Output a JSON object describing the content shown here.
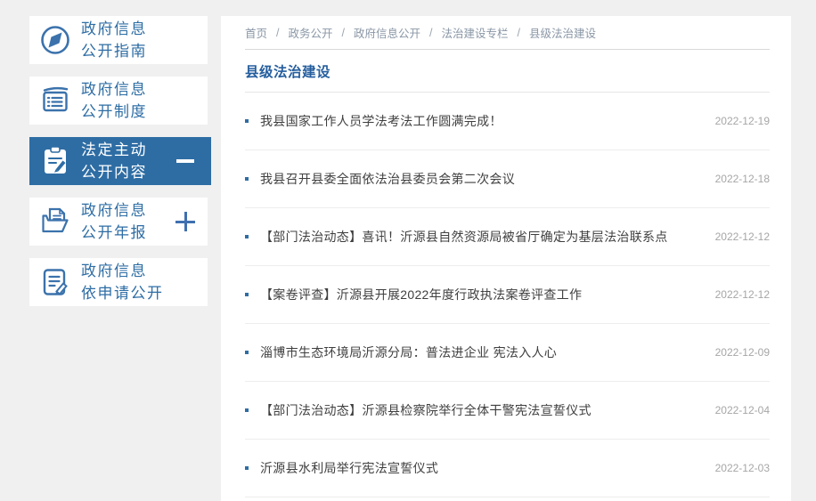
{
  "colors": {
    "accent": "#2e6da4",
    "page_background": "#f0f0f1",
    "panel_background": "#ffffff",
    "date_gray": "#a6a6a6"
  },
  "sidebar": {
    "items": [
      {
        "icon": "compass-icon",
        "lines": [
          "政府信息",
          "公开指南"
        ],
        "active": false,
        "expander": null
      },
      {
        "icon": "notebook-list-icon",
        "lines": [
          "政府信息",
          "公开制度"
        ],
        "active": false,
        "expander": null
      },
      {
        "icon": "clipboard-pen-icon",
        "lines": [
          "法定主动",
          "公开内容"
        ],
        "active": true,
        "expander": "minus"
      },
      {
        "icon": "folder-document-icon",
        "lines": [
          "政府信息",
          "公开年报"
        ],
        "active": false,
        "expander": "plus"
      },
      {
        "icon": "document-pen-icon",
        "lines": [
          "政府信息",
          "依申请公开"
        ],
        "active": false,
        "expander": null
      }
    ]
  },
  "breadcrumb": {
    "separator": "/",
    "items": [
      "首页",
      "政务公开",
      "政府信息公开",
      "法治建设专栏",
      "县级法治建设"
    ]
  },
  "main": {
    "section_title": "县级法治建设",
    "articles": [
      {
        "title": "我县国家工作人员学法考法工作圆满完成！",
        "date": "2022-12-19"
      },
      {
        "title": "我县召开县委全面依法治县委员会第二次会议",
        "date": "2022-12-18"
      },
      {
        "title": "【部门法治动态】喜讯！沂源县自然资源局被省厅确定为基层法治联系点",
        "date": "2022-12-12"
      },
      {
        "title": "【案卷评查】沂源县开展2022年度行政执法案卷评查工作",
        "date": "2022-12-12"
      },
      {
        "title": "淄博市生态环境局沂源分局：普法进企业 宪法入人心",
        "date": "2022-12-09"
      },
      {
        "title": "【部门法治动态】沂源县检察院举行全体干警宪法宣誓仪式",
        "date": "2022-12-04"
      },
      {
        "title": "沂源县水利局举行宪法宣誓仪式",
        "date": "2022-12-03"
      }
    ]
  }
}
